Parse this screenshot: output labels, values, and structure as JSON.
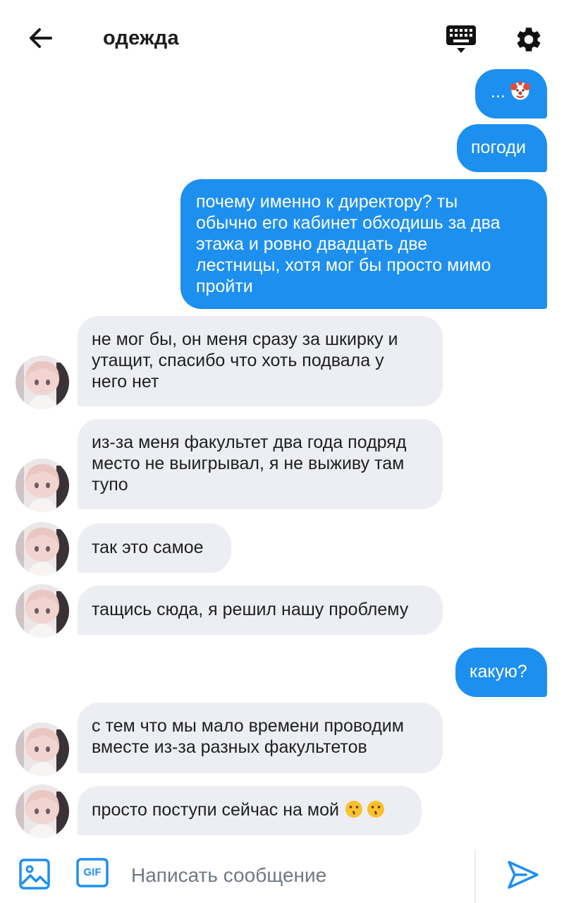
{
  "header": {
    "title": "одежда",
    "back_icon": "arrow-left-icon",
    "keyboard_icon": "keyboard-icon",
    "settings_icon": "gear-icon"
  },
  "colors": {
    "outgoing_bubble": "#1d8fef",
    "incoming_bubble": "#eceef3",
    "accent": "#1d8fef"
  },
  "messages": [
    {
      "direction": "out",
      "text": "... ",
      "emoji": "clown-face"
    },
    {
      "direction": "out",
      "text": "погоди"
    },
    {
      "direction": "out",
      "lines": [
        "почему именно к директору? ты",
        "обычно его кабинет обходишь за два",
        "этажа и ровно двадцать две",
        "лестницы, хотя мог бы просто мимо",
        "пройти"
      ]
    },
    {
      "direction": "in",
      "lines": [
        "не мог бы, он меня сразу за шкирку и",
        "утащит, спасибо что хоть подвала у",
        "него нет"
      ]
    },
    {
      "direction": "in",
      "lines": [
        "из-за меня факультет два года подряд",
        "место не выигрывал, я не выживу там",
        "тупо"
      ]
    },
    {
      "direction": "in",
      "text": "так это самое"
    },
    {
      "direction": "in",
      "text": "тащись сюда, я решил нашу проблему"
    },
    {
      "direction": "out",
      "text": "какую?"
    },
    {
      "direction": "in",
      "lines": [
        "с тем что мы мало времени проводим",
        "вместе из-за разных факультетов"
      ]
    },
    {
      "direction": "in",
      "text": "просто поступи сейчас на мой ",
      "emoji": "kissing-face x2"
    }
  ],
  "composer": {
    "placeholder": "Написать сообщение",
    "image_icon": "image-icon",
    "gif_label": "GIF",
    "send_icon": "send-icon"
  }
}
